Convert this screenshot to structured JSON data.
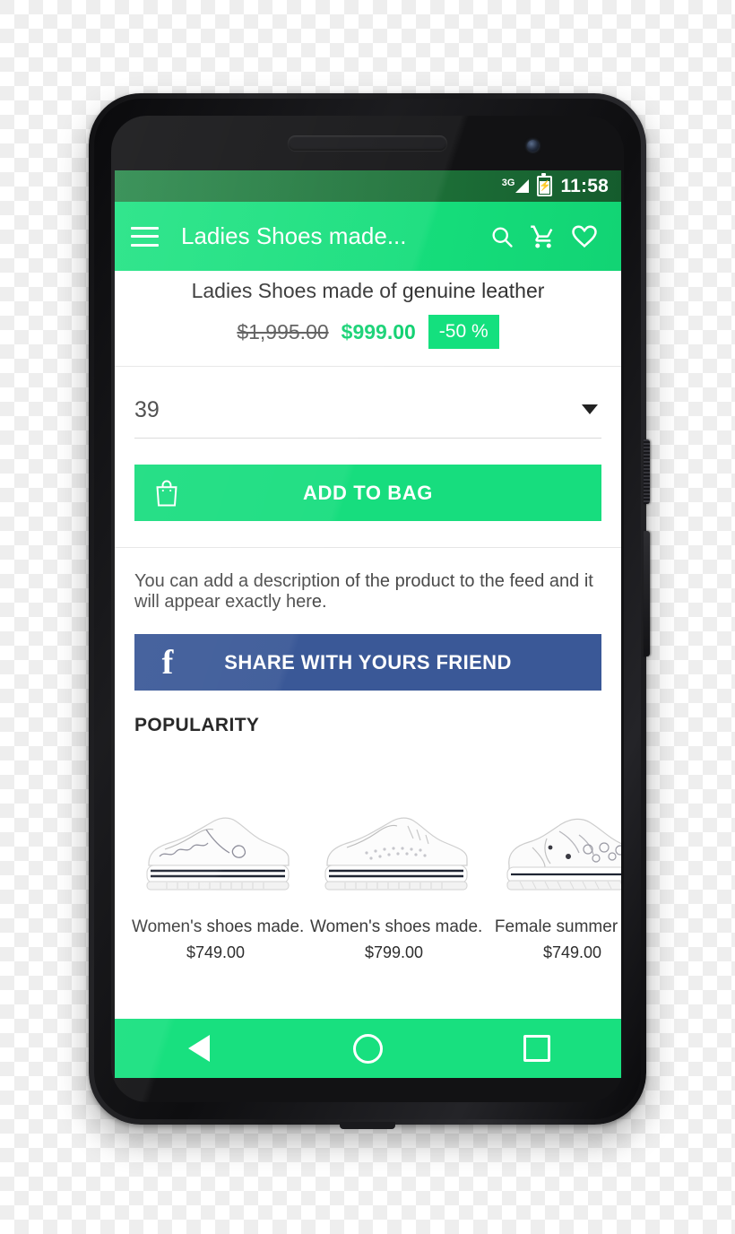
{
  "status_bar": {
    "network": "3G",
    "signal_icon": "signal-triangle-icon",
    "battery_icon": "battery-charging-icon",
    "time": "11:58"
  },
  "app_bar": {
    "menu_icon": "hamburger-menu-icon",
    "title": "Ladies Shoes made...",
    "search_icon": "search-icon",
    "cart_icon": "shopping-cart-icon",
    "favorite_icon": "heart-outline-icon"
  },
  "product": {
    "title": "Ladies Shoes made of genuine leather",
    "old_price": "$1,995.00",
    "new_price": "$999.00",
    "discount_badge": "-50 %",
    "size_label": "39",
    "size_caret_icon": "chevron-down-icon",
    "add_to_bag_label": "ADD TO BAG",
    "bag_icon": "shopping-bag-icon",
    "description": "You can add a description of the product to the feed and it will appear exactly here.",
    "share_label": "SHARE WITH YOURS FRIEND",
    "facebook_icon": "facebook-icon"
  },
  "popularity": {
    "heading": "POPULARITY",
    "cards": [
      {
        "name": "Women's shoes made...",
        "price": "$749.00",
        "image": "white-platform-sneaker-image"
      },
      {
        "name": "Women's shoes made...",
        "price": "$799.00",
        "image": "white-perforated-sneaker-image"
      },
      {
        "name": "Female summer sho",
        "price": "$749.00",
        "image": "white-cutout-platform-shoe-image"
      }
    ]
  },
  "nav_bar": {
    "back_icon": "back-triangle-icon",
    "home_icon": "home-circle-icon",
    "recents_icon": "recents-square-icon"
  },
  "device": {
    "earpiece": "earpiece-speaker",
    "front_camera": "front-camera",
    "bottom_speaker": "bottom-speaker",
    "power_button": "power-button",
    "volume_button": "volume-rocker"
  },
  "colors": {
    "accent_green": "#17dd7e",
    "status_bar_green": "#1d7038",
    "facebook_blue": "#3a5897",
    "price_green": "#14d173"
  }
}
